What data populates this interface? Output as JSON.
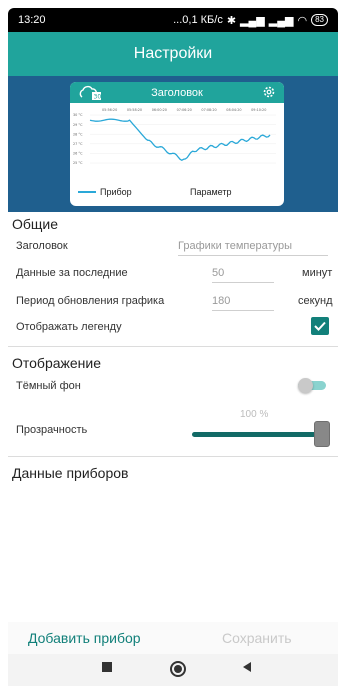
{
  "status": {
    "time": "13:20",
    "speed": "...0,1 КБ/с",
    "battery": "83"
  },
  "appbar": {
    "title": "Настройки"
  },
  "preview": {
    "title": "Заголовок",
    "legend": {
      "series": "Прибор",
      "param": "Параметр"
    },
    "x_ticks": [
      "05:56:20",
      "05:58:20",
      "06:00:20",
      "07:06:20",
      "07:08:20",
      "08:04:20",
      "09:10:20"
    ],
    "y_ticks": [
      "30 °C",
      "29 °C",
      "28 °C",
      "27 °C",
      "26 °C",
      "25 °C"
    ],
    "line_color": "#2aa8d8"
  },
  "general": {
    "title": "Общие",
    "header_label": "Заголовок",
    "header_placeholder": "Графики температуры",
    "data_label": "Данные за последние",
    "data_value": "50",
    "data_unit": "минут",
    "period_label": "Период обновления графика",
    "period_value": "180",
    "period_unit": "секунд",
    "legend_label": "Отображать легенду",
    "legend_checked": true
  },
  "display": {
    "title": "Отображение",
    "dark_label": "Тёмный фон",
    "dark_on": false,
    "opacity_label": "Прозрачность",
    "opacity_value": "100 %",
    "opacity_fraction": 1.0
  },
  "devices": {
    "title": "Данные приборов"
  },
  "actions": {
    "add": "Добавить прибор",
    "save": "Сохранить"
  },
  "colors": {
    "accent": "#20a49c",
    "accent_dark": "#12807a",
    "preview_bg": "#1f5f8e"
  }
}
